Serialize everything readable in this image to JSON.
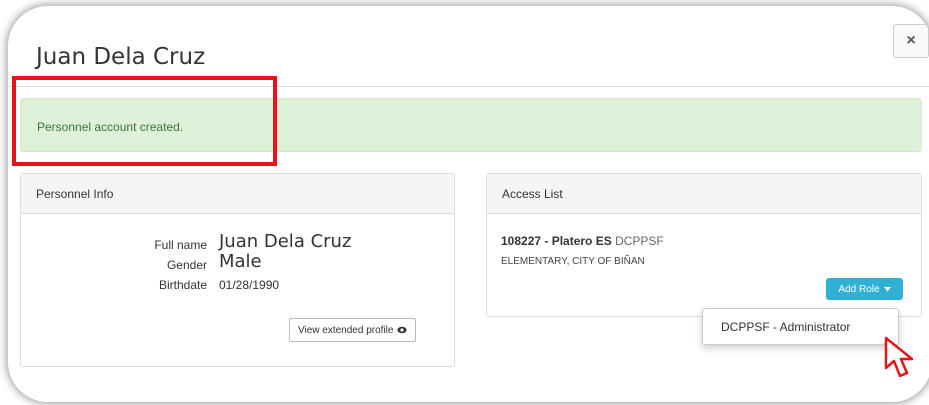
{
  "modal": {
    "title": "Juan Dela Cruz",
    "close_label": "×"
  },
  "alert": {
    "message": "Personnel account created."
  },
  "personnel_info": {
    "heading": "Personnel Info",
    "full_name_label": "Full name",
    "full_name_value": "Juan Dela Cruz",
    "gender_label": "Gender",
    "gender_value": "Male",
    "birthdate_label": "Birthdate",
    "birthdate_value": "01/28/1990",
    "extended_profile_button": "View extended profile"
  },
  "access_list": {
    "heading": "Access List",
    "school_code_name": "108227 - Platero ES",
    "school_tag": "DCPPSF",
    "school_subtitle": "ELEMENTARY, CITY OF BIÑAN",
    "add_role_button": "Add Role",
    "dropdown_items": [
      "DCPPSF - Administrator"
    ]
  },
  "colors": {
    "alert_bg": "#dff0d8",
    "alert_text": "#3c763d",
    "highlight_border": "#e5141c",
    "add_role_bg": "#31b0d5"
  },
  "icons": [
    "eye-icon",
    "caret-down-icon",
    "cursor-pointer-icon"
  ]
}
